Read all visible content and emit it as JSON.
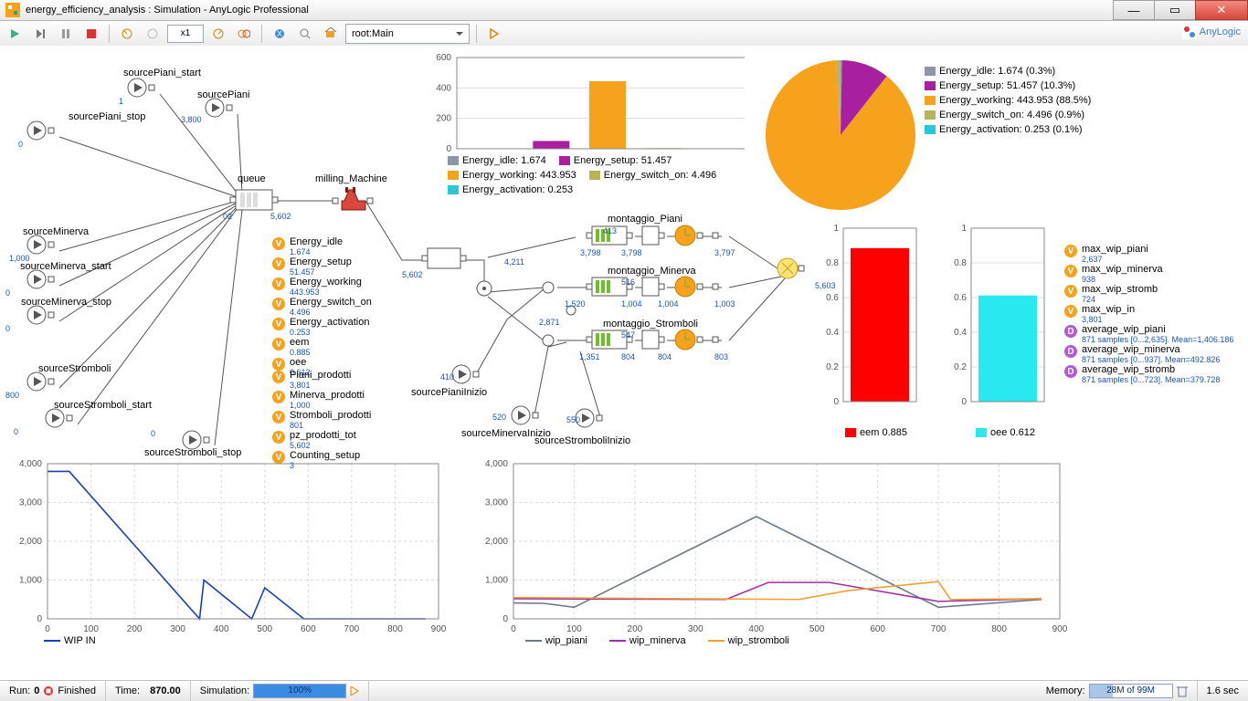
{
  "window": {
    "title": "energy_efficiency_analysis : Simulation - AnyLogic Professional"
  },
  "toolbar": {
    "speed": "x1",
    "root": "root:Main",
    "brand": "AnyLogic"
  },
  "labels": {
    "sourcePiani_start": "sourcePiani_start",
    "sourcePiani": "sourcePiani",
    "sourcePiani_stop": "sourcePiani_stop",
    "sourceMinerva": "sourceMinerva",
    "sourceMinerva_start": "sourceMinerva_start",
    "sourceMinerva_stop": "sourceMinerva_stop",
    "sourceStromboli": "sourceStromboli",
    "sourceStromboli_start": "sourceStromboli_start",
    "sourceStromboli_stop": "sourceStromboli_stop",
    "queue": "queue",
    "milling": "milling_Machine",
    "montaggio_Piani": "montaggio_Piani",
    "montaggio_Minerva": "montaggio_Minerva",
    "montaggio_Stromboli": "montaggio_Stromboli",
    "sourcePianiInizio": "sourcePianiInizio",
    "sourceMinervaInizio": "sourceMinervaInizio",
    "sourceStromboliInizio": "sourceStromboliInizio"
  },
  "values": {
    "sourcePiani_start": "1",
    "sourcePiani": "3,800",
    "sourcePiani_stop": "0",
    "sourceMinerva": "1,000",
    "sourceMinerva_start": "0",
    "sourceMinerva_stop": "0",
    "sourceStromboli": "800",
    "sourceStromboli_start": "0",
    "sourceStromboli_stop": "0",
    "queue_in": "02",
    "queue_out": "5,602",
    "mill_out": "5,602",
    "split_left": "5,602",
    "split_up": "4,211",
    "split_down": "2,871",
    "mp_in": "413",
    "mp_a": "3,798",
    "mp_b": "3,798",
    "mp_c": "3,797",
    "mm_in": "516",
    "mm_l": "1,520",
    "mm_a": "1,004",
    "mm_b": "1,004",
    "mm_c": "1,003",
    "ms_in": "547",
    "ms_l": "1,351",
    "ms_a": "804",
    "ms_b": "804",
    "ms_c": "803",
    "sink": "5,603",
    "sourcePianiInizio": "410",
    "sourceMinervaInizio": "520",
    "sourceStromboliInizio": "550"
  },
  "vars_energy": [
    {
      "name": "Energy_idle",
      "val": "1.674"
    },
    {
      "name": "Energy_setup",
      "val": "51.457"
    },
    {
      "name": "Energy_working",
      "val": "443.953"
    },
    {
      "name": "Energy_switch_on",
      "val": "4.496"
    },
    {
      "name": "Energy_activation",
      "val": "0.253"
    },
    {
      "name": "eem",
      "val": "0.885"
    },
    {
      "name": "oee",
      "val": "0.612"
    }
  ],
  "vars_prod": [
    {
      "name": "Piani_prodotti",
      "val": "3,801"
    },
    {
      "name": "Minerva_prodotti",
      "val": "1,000"
    },
    {
      "name": "Stromboli_prodotti",
      "val": "801"
    },
    {
      "name": "pz_prodotti_tot",
      "val": "5,602"
    },
    {
      "name": "Counting_setup",
      "val": "3"
    }
  ],
  "wip_vars": [
    {
      "t": "V",
      "name": "max_wip_piani",
      "val": "2,637"
    },
    {
      "t": "V",
      "name": "max_wip_minerva",
      "val": "938"
    },
    {
      "t": "V",
      "name": "max_wip_stromb",
      "val": "724"
    },
    {
      "t": "V",
      "name": "max_wip_in",
      "val": "3,801"
    },
    {
      "t": "D",
      "name": "average_wip_piani",
      "val": "871 samples [0...2,635]. Mean=1,406.186"
    },
    {
      "t": "D",
      "name": "average_wip_minerva",
      "val": "871 samples [0...937]. Mean=492.826"
    },
    {
      "t": "D",
      "name": "average_wip_stromb",
      "val": "871 samples [0...723]. Mean=379.728"
    }
  ],
  "pie": [
    {
      "label": "Energy_idle: 1.674 (0.3%)",
      "color": "#8c96a6",
      "v": 1.674
    },
    {
      "label": "Energy_setup: 51.457 (10.3%)",
      "color": "#a81f9f",
      "v": 51.457
    },
    {
      "label": "Energy_working: 443.953 (88.5%)",
      "color": "#f6a21c",
      "v": 443.953
    },
    {
      "label": "Energy_switch_on: 4.496 (0.9%)",
      "color": "#b8b45a",
      "v": 4.496
    },
    {
      "label": "Energy_activation: 0.253 (0.1%)",
      "color": "#28c8d8",
      "v": 0.253
    }
  ],
  "bars_labels": {
    "eem": "eem  0.885",
    "oee": "oee  0.612"
  },
  "chart_legends": {
    "energy_bar": [
      {
        "label": "Energy_idle: 1.674",
        "color": "#8c96a6"
      },
      {
        "label": "Energy_setup: 51.457",
        "color": "#a81f9f"
      },
      {
        "label": "Energy_working: 443.953",
        "color": "#f6a21c"
      },
      {
        "label": "Energy_switch_on: 4.496",
        "color": "#b8b45a"
      },
      {
        "label": "Energy_activation: 0.253",
        "color": "#28c8d8"
      }
    ],
    "wip_in": [
      {
        "label": "WIP IN",
        "color": "#1a3fb5"
      }
    ],
    "wip_multi": [
      {
        "label": "wip_piani",
        "color": "#6a7a8a"
      },
      {
        "label": "wip_minerva",
        "color": "#a12fa8"
      },
      {
        "label": "wip_stromboli",
        "color": "#f0a030"
      }
    ]
  },
  "status": {
    "run": "Run:",
    "run_n": "0",
    "finished": "Finished",
    "time_l": "Time:",
    "time_v": "870.00",
    "sim_l": "Simulation:",
    "sim_pct": "100%",
    "mem_l": "Memory:",
    "mem_v": "28M of 99M",
    "sec": "1.6 sec"
  },
  "chart_data": [
    {
      "id": "energy_bar",
      "type": "bar",
      "ylim": [
        0,
        600
      ],
      "yticks": [
        0,
        200,
        400,
        600
      ],
      "categories": [
        "Energy_idle",
        "Energy_setup",
        "Energy_working",
        "Energy_switch_on",
        "Energy_activation"
      ],
      "values": [
        1.674,
        51.457,
        443.953,
        4.496,
        0.253
      ],
      "colors": [
        "#8c96a6",
        "#a81f9f",
        "#f6a21c",
        "#b8b45a",
        "#28c8d8"
      ]
    },
    {
      "id": "energy_pie",
      "type": "pie",
      "series": [
        {
          "name": "Energy_idle",
          "value": 1.674,
          "pct": 0.3,
          "color": "#8c96a6"
        },
        {
          "name": "Energy_setup",
          "value": 51.457,
          "pct": 10.3,
          "color": "#a81f9f"
        },
        {
          "name": "Energy_working",
          "value": 443.953,
          "pct": 88.5,
          "color": "#f6a21c"
        },
        {
          "name": "Energy_switch_on",
          "value": 4.496,
          "pct": 0.9,
          "color": "#b8b45a"
        },
        {
          "name": "Energy_activation",
          "value": 0.253,
          "pct": 0.1,
          "color": "#28c8d8"
        }
      ]
    },
    {
      "id": "eem_bar",
      "type": "bar",
      "ylim": [
        0,
        1
      ],
      "yticks": [
        0,
        0.2,
        0.4,
        0.6,
        0.8,
        1
      ],
      "categories": [
        "eem"
      ],
      "values": [
        0.885
      ],
      "colors": [
        "#ff0000"
      ]
    },
    {
      "id": "oee_bar",
      "type": "bar",
      "ylim": [
        0,
        1
      ],
      "yticks": [
        0,
        0.2,
        0.4,
        0.6,
        0.8,
        1
      ],
      "categories": [
        "oee"
      ],
      "values": [
        0.612
      ],
      "colors": [
        "#28e8f0"
      ]
    },
    {
      "id": "wip_in",
      "type": "line",
      "xlim": [
        0,
        900
      ],
      "ylim": [
        0,
        4000
      ],
      "xticks": [
        0,
        100,
        200,
        300,
        400,
        500,
        600,
        700,
        800,
        900
      ],
      "yticks": [
        0,
        1000,
        2000,
        3000,
        4000
      ],
      "series": [
        {
          "name": "WIP IN",
          "color": "#1a3fb5",
          "points": [
            [
              0,
              3801
            ],
            [
              50,
              3801
            ],
            [
              350,
              0
            ],
            [
              360,
              1000
            ],
            [
              470,
              0
            ],
            [
              500,
              800
            ],
            [
              590,
              0
            ],
            [
              870,
              0
            ]
          ]
        }
      ]
    },
    {
      "id": "wip_multi",
      "type": "line",
      "xlim": [
        0,
        900
      ],
      "ylim": [
        0,
        4000
      ],
      "xticks": [
        0,
        100,
        200,
        300,
        400,
        500,
        600,
        700,
        800,
        900
      ],
      "yticks": [
        0,
        1000,
        2000,
        3000,
        4000
      ],
      "series": [
        {
          "name": "wip_piani",
          "color": "#6a7a8a",
          "points": [
            [
              0,
              410
            ],
            [
              50,
              400
            ],
            [
              100,
              300
            ],
            [
              400,
              2637
            ],
            [
              700,
              300
            ],
            [
              870,
              500
            ]
          ]
        },
        {
          "name": "wip_minerva",
          "color": "#a12fa8",
          "points": [
            [
              0,
              520
            ],
            [
              350,
              500
            ],
            [
              420,
              938
            ],
            [
              520,
              938
            ],
            [
              700,
              450
            ],
            [
              870,
              520
            ]
          ]
        },
        {
          "name": "wip_stromboli",
          "color": "#f0a030",
          "points": [
            [
              0,
              550
            ],
            [
              470,
              500
            ],
            [
              550,
              724
            ],
            [
              700,
              960
            ],
            [
              720,
              500
            ],
            [
              870,
              520
            ]
          ]
        }
      ]
    }
  ]
}
